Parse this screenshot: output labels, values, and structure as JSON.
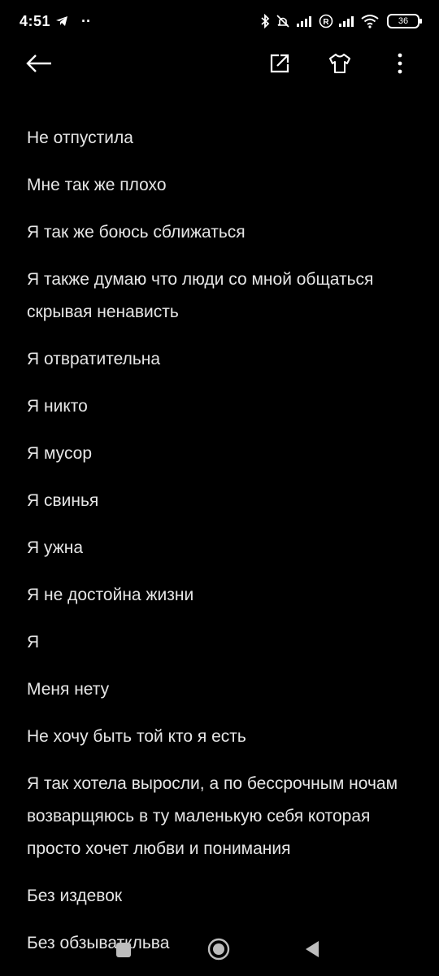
{
  "status_bar": {
    "time": "4:51",
    "dots": "··",
    "battery_level": "36"
  },
  "toolbar": {
    "back_icon": "arrow-left-icon",
    "share_icon": "share-external-icon",
    "theme_icon": "tshirt-icon",
    "more_icon": "more-vertical-icon"
  },
  "note": {
    "lines": [
      "Не отпустила",
      "Мне так же плохо",
      "Я так же боюсь сближаться",
      "Я также думаю что люди со мной общаться скрывая ненависть",
      "Я отвратительна",
      "Я никто",
      "Я мусор",
      "Я свинья",
      "Я ужна",
      "Я не достойна жизни",
      "Я",
      "Меня нету",
      "Не хочу быть той кто я есть",
      "Я так хотела выросли, а по бессрочным ночам возварщяюсь в ту маленькую себя которая просто хочет любви и понимания",
      "Без издевок",
      "Без обзываткльва"
    ]
  },
  "colors": {
    "background": "#000000",
    "text": "#e6e6e6",
    "icon": "#ffffff"
  }
}
